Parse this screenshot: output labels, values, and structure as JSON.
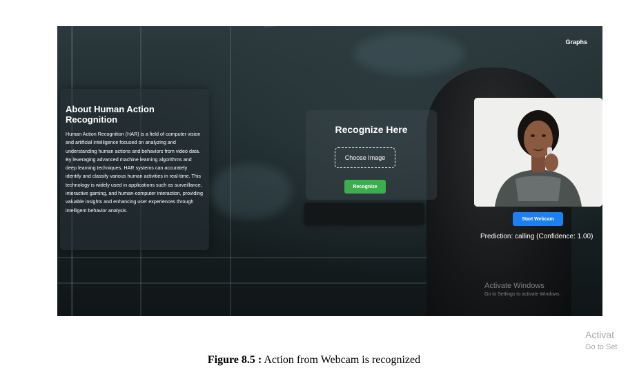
{
  "header": {
    "graphs_link": "Graphs"
  },
  "about": {
    "title": "About Human Action Recognition",
    "text": "Human Action Recognition (HAR) is a field of computer vision and artificial intelligence focused on analyzing and understanding human actions and behaviors from video data. By leveraging advanced machine learning algorithms and deep learning techniques, HAR systems can accurately identify and classify various human activities in real-time. This technology is widely used in applications such as surveillance, interactive gaming, and human-computer interaction, providing valuable insights and enhancing user experiences through intelligent behavior analysis."
  },
  "recognize": {
    "title": "Recognize Here",
    "choose_label": "Choose Image",
    "recognize_label": "Recognize"
  },
  "webcam": {
    "start_label": "Start Webcam",
    "prediction": "Prediction: calling (Confidence: 1.00)"
  },
  "watermark_inner": {
    "line1": "Activate Windows",
    "line2": "Go to Settings to activate Windows."
  },
  "watermark_outer": {
    "line1": "Activat",
    "line2": "Go to Set"
  },
  "caption": {
    "label": "Figure 8.5 :",
    "text": " Action from Webcam is recognized"
  },
  "colors": {
    "recognize_button": "#3cae4e",
    "webcam_button": "#1d7ff0"
  }
}
